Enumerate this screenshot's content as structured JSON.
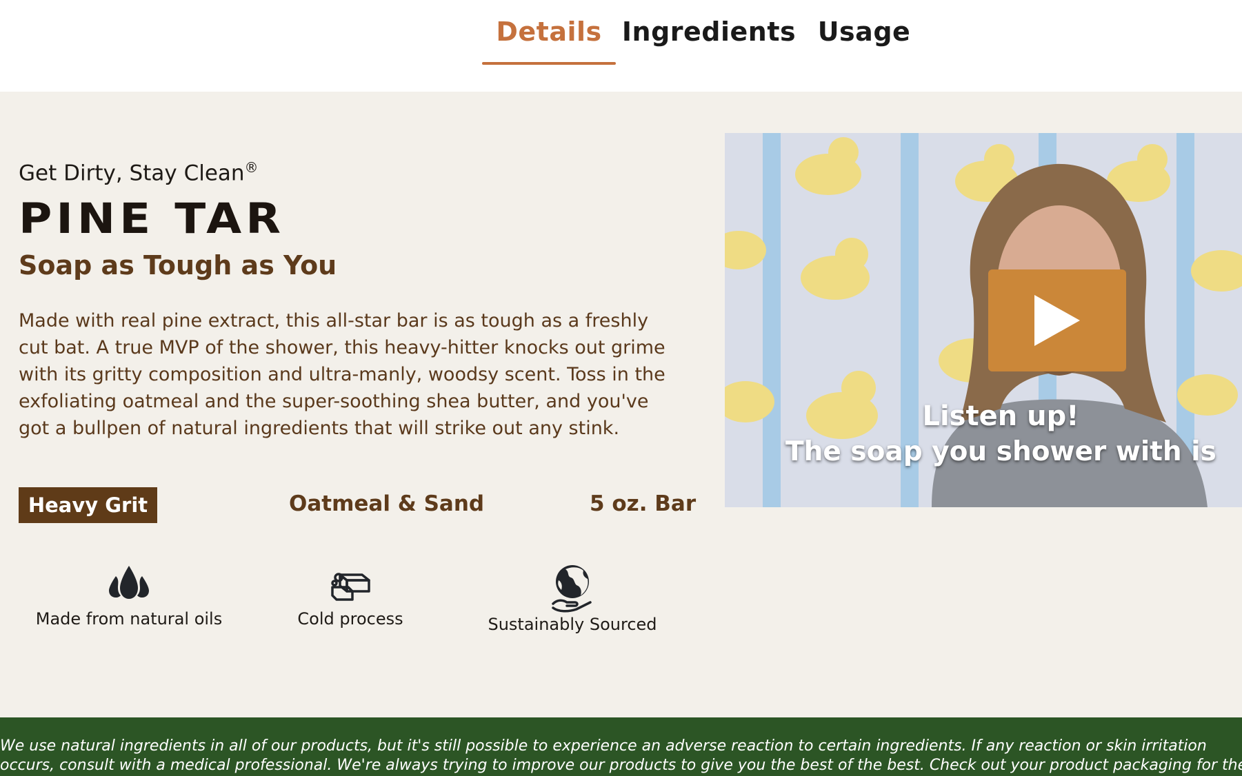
{
  "tabs": [
    {
      "label": "Details",
      "active": true
    },
    {
      "label": "Ingredients",
      "active": false
    },
    {
      "label": "Usage",
      "active": false
    }
  ],
  "product": {
    "tagline": "Get Dirty, Stay Clean",
    "tagline_mark": "®",
    "name": "PINE TAR",
    "subtitle": "Soap as Tough as You",
    "description": "Made with real pine extract, this all-star bar is as tough as a freshly cut bat. A true MVP of the shower, this heavy-hitter knocks out grime with its gritty composition and ultra-manly, woodsy scent. Toss in the exfoliating oatmeal and the super-soothing shea butter, and you've got a bullpen of natural ingredients that will strike out any stink."
  },
  "specs": {
    "grit": "Heavy Grit",
    "exfoliants": "Oatmeal & Sand",
    "size": "5 oz. Bar"
  },
  "features": [
    {
      "icon": "oil-drops-icon",
      "label": "Made from natural oils"
    },
    {
      "icon": "soap-bars-icon",
      "label": "Cold process"
    },
    {
      "icon": "globe-in-hand-icon",
      "label": "Sustainably Sourced"
    }
  ],
  "video": {
    "caption_line1": "Listen up!",
    "caption_line2": "The soap you shower with is",
    "play_icon": "play-icon"
  },
  "footer": {
    "disclaimer": "We use natural ingredients in all of our products, but it's still possible to experience an adverse reaction to certain ingredients. If any reaction or skin irritation occurs, consult with a medical professional. We're always trying to improve our products to give you the best of the best. Check out your product packaging for the most up-to-date ingredients."
  },
  "colors": {
    "accent": "#c5713d",
    "brown": "#5e3b1b",
    "panel_bg": "#f3f0ea",
    "footer_bg": "#2c5525",
    "play_button": "#cb8739"
  }
}
